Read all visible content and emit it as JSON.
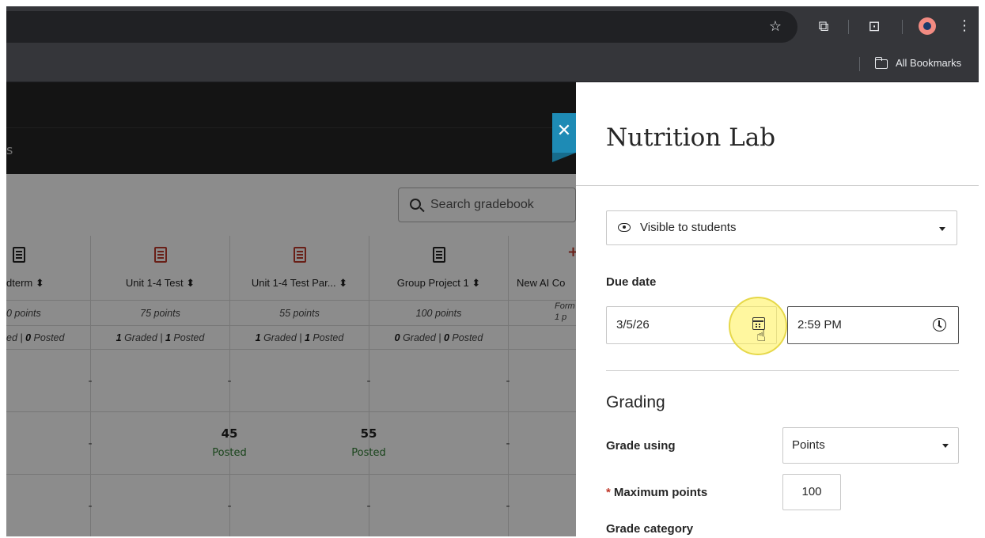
{
  "browser": {
    "bookmarks_label": "All Bookmarks",
    "icons": [
      "star-icon",
      "extensions-icon",
      "reading-list-icon",
      "profile-avatar",
      "menu-icon"
    ]
  },
  "gradebook": {
    "header_partial": "s",
    "search_placeholder": "Search gradebook",
    "columns": [
      {
        "title": "dterm ⬍",
        "points": "0 points",
        "graded": "",
        "graded_count": "",
        "posted_count": "0",
        "status_prefix": "ed | ",
        "icon": "document-icon"
      },
      {
        "title": "Unit 1-4 Test ⬍",
        "points": "75 points",
        "graded_count": "1",
        "posted_count": "1",
        "icon": "document-icon-red"
      },
      {
        "title": "Unit 1-4 Test Par... ⬍",
        "points": "55 points",
        "graded_count": "1",
        "posted_count": "1",
        "icon": "document-icon-red"
      },
      {
        "title": "Group Project 1 ⬍",
        "points": "100 points",
        "graded_count": "0",
        "posted_count": "0",
        "icon": "checklist-icon"
      },
      {
        "title": "New AI Co",
        "points": "1 p",
        "subtitle": "Form",
        "icon": "plus-icon-red"
      }
    ],
    "rows": [
      [
        "-",
        "-",
        "-",
        "-",
        ""
      ],
      [
        "-",
        {
          "grade": "45",
          "status": "Posted"
        },
        {
          "grade": "55",
          "status": "Posted"
        },
        "-",
        ""
      ],
      [
        "-",
        "-",
        "-",
        "-",
        ""
      ]
    ],
    "graded_word": "Graded",
    "posted_word": "Posted"
  },
  "panel": {
    "title": "Nutrition Lab",
    "visibility": "Visible to students",
    "due_date_label": "Due date",
    "due_date": "3/5/26",
    "due_time": "2:59 PM",
    "grading_heading": "Grading",
    "grade_using_label": "Grade using",
    "grade_using_value": "Points",
    "max_points_label": "Maximum points",
    "max_points_value": "100",
    "grade_category_label": "Grade category"
  },
  "colors": {
    "accent": "#1e8bb5",
    "posted": "#2e7d32",
    "required": "#c0392b",
    "highlight": "#fff050"
  }
}
